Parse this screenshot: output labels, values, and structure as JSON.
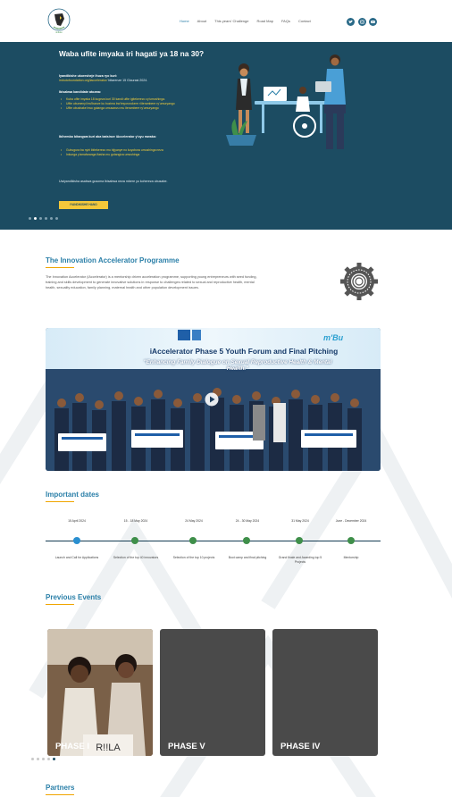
{
  "colors": {
    "hero_bg": "#1c4c62",
    "accent_blue": "#2a7fa8",
    "accent_yellow": "#f3cf3c",
    "timeline_dot_blue": "#2a8fd0",
    "timeline_dot_green": "#3f8f4a"
  },
  "header": {
    "nav": [
      "Home",
      "About",
      "This years' Challenge",
      "Road Map",
      "FAQs",
      "Contact"
    ],
    "social_icons": [
      "twitter-icon",
      "instagram-icon",
      "youtube-icon"
    ]
  },
  "hero": {
    "title": "Waba ufite imyaka iri hagati ya 18 na 30?",
    "apply_intro": "Iyandikishe ukoresheje ihuza ryo kuri:",
    "apply_link": "imbutofoundation.org/iaccelerator/",
    "apply_deadline": "bitarenze 15 Gicurasi 2024.",
    "criteria_heading": "Ibisabwa kandidate atozwa:",
    "criteria": [
      "Kuba ufite imyaka 18 kugeza kuri 30 kandi ufite igitekerezo cy'umushinga.",
      "Ufite ubumenyi bw'ibanze ku buzima bw'imyororokere n'iterambere ry'umuryango",
      "Ufite ubushake bwo gutanga umusanzu mu iterambere ry'umuryango"
    ],
    "benefits_heading": "Ibihembo bitangwa kuri aba batsinze iAccelerator y'uyu mwaka:",
    "benefits": [
      "Guhugura ba nyiri ibitekerezo mu bijyanye no kuyobora umushinga neza",
      "Inkunga y'amafaranga ifasha mu gutangiza umushinga"
    ],
    "closing": "Uwiyandikisha asabwa gusoma ibisabwa neza mbere yo kohereza ubusabe.",
    "cta_label": "IYANDIKISHE HANO"
  },
  "intro": {
    "title": "The Innovation Accelerator Programme",
    "body": "The Innovation Accelerator (iAccelerator) is a mentorship driven acceleration programme, supporting young entrepreneurs with seed funding, training and skills development to generate innovative solutions in response to challenges related to sexual and reproductive health, mental health, sexuality education, family planning, maternal health and other population development issues."
  },
  "video": {
    "title": "iAccelerator Phase 5 Youth Forum and Final Pitching",
    "subtitle": "\"Enhancing Family Dialogue on Sexual Reproductive Health & Mental Health.\""
  },
  "important_dates": {
    "title": "Important dates",
    "items": [
      {
        "date": "15 April 2024",
        "label": "Launch and Call for Applications",
        "color": "#2a8fd0"
      },
      {
        "date": "15 - 18 May 2024",
        "label": "Selection of the top 40 innovators",
        "color": "#3f8f4a"
      },
      {
        "date": "24 May 2024",
        "label": "Selection of the top 10 projects",
        "color": "#3f8f4a"
      },
      {
        "date": "24 - 30 May 2024",
        "label": "Boot camp and final pitching",
        "color": "#3f8f4a"
      },
      {
        "date": "31 May 2024",
        "label": "Grand finale and Awarding top 5 Projects",
        "color": "#3f8f4a"
      },
      {
        "date": "June - December 2024",
        "label": "Mentorship",
        "color": "#3f8f4a"
      }
    ]
  },
  "previous_events": {
    "title": "Previous Events",
    "cards": [
      "PHASE I",
      "PHASE V",
      "PHASE IV"
    ]
  },
  "partners": {
    "title": "Partners"
  }
}
